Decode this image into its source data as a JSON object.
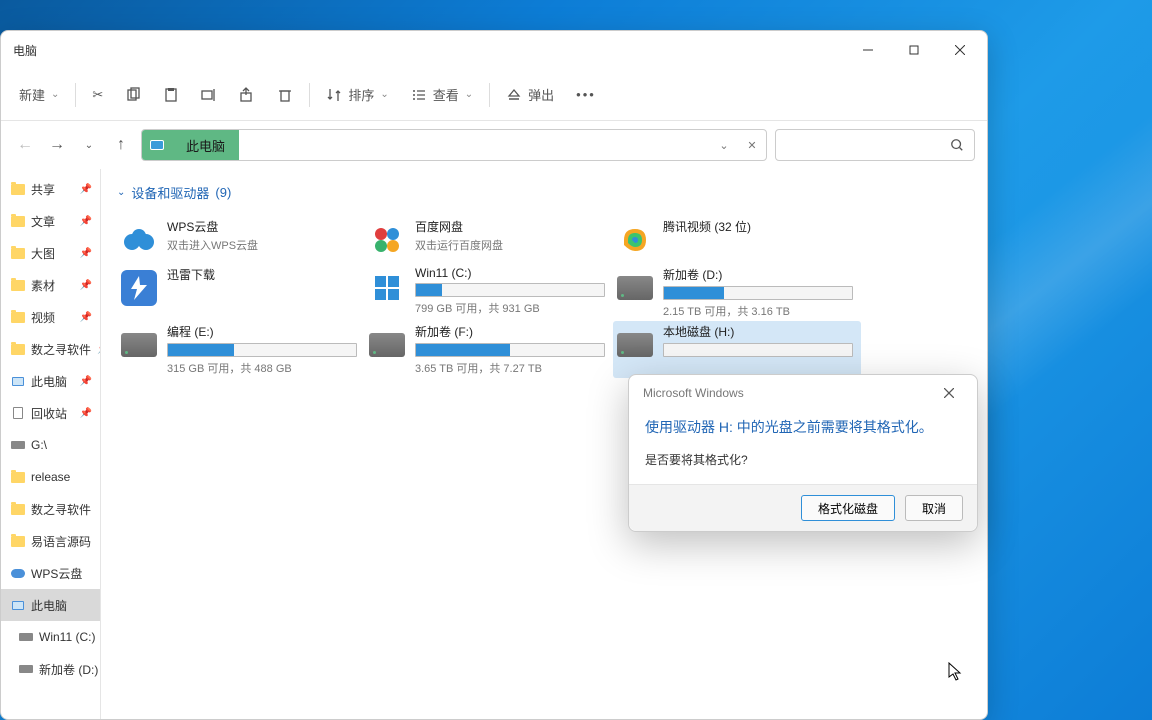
{
  "window": {
    "title": "电脑"
  },
  "toolbar": {
    "new": "新建",
    "sort": "排序",
    "view": "查看",
    "eject": "弹出"
  },
  "crumbs": {
    "current": "此电脑"
  },
  "sidebar": [
    {
      "label": "共享",
      "icon": "folder",
      "pinned": true
    },
    {
      "label": "文章",
      "icon": "folder",
      "pinned": true
    },
    {
      "label": "大图",
      "icon": "folder",
      "pinned": true
    },
    {
      "label": "素材",
      "icon": "folder",
      "pinned": true
    },
    {
      "label": "视频",
      "icon": "folder",
      "pinned": true
    },
    {
      "label": "数之寻软件",
      "icon": "folder",
      "pinned": true
    },
    {
      "label": "此电脑",
      "icon": "pc",
      "pinned": true
    },
    {
      "label": "回收站",
      "icon": "bin",
      "pinned": true
    },
    {
      "label": "G:\\",
      "icon": "drive",
      "pinned": false
    },
    {
      "label": "release",
      "icon": "folder",
      "pinned": false
    },
    {
      "label": "数之寻软件",
      "icon": "folder",
      "pinned": false
    },
    {
      "label": "易语言源码",
      "icon": "folder",
      "pinned": false
    },
    {
      "label": "WPS云盘",
      "icon": "cloud",
      "pinned": false
    },
    {
      "label": "此电脑",
      "icon": "pc",
      "pinned": false,
      "selected": true
    },
    {
      "label": "Win11 (C:)",
      "icon": "drive",
      "pinned": false,
      "indent": true
    },
    {
      "label": "新加卷 (D:)",
      "icon": "drive",
      "pinned": false,
      "indent": true
    }
  ],
  "group": {
    "title": "设备和驱动器",
    "count": "(9)"
  },
  "items": [
    {
      "name": "WPS云盘",
      "sub": "双击进入WPS云盘",
      "kind": "app",
      "icon": "wps"
    },
    {
      "name": "百度网盘",
      "sub": "双击运行百度网盘",
      "kind": "app",
      "icon": "baidu"
    },
    {
      "name": "腾讯视频 (32 位)",
      "sub": "",
      "kind": "app",
      "icon": "tencent"
    },
    {
      "name": "迅雷下载",
      "sub": "",
      "kind": "app",
      "icon": "thunder"
    },
    {
      "name": "Win11 (C:)",
      "sub": "799 GB 可用，共 931 GB",
      "kind": "drive",
      "fill": 14,
      "win": true
    },
    {
      "name": "新加卷 (D:)",
      "sub": "2.15 TB 可用，共 3.16 TB",
      "kind": "drive",
      "fill": 32
    },
    {
      "name": "编程 (E:)",
      "sub": "315 GB 可用，共 488 GB",
      "kind": "drive",
      "fill": 35
    },
    {
      "name": "新加卷 (F:)",
      "sub": "3.65 TB 可用，共 7.27 TB",
      "kind": "drive",
      "fill": 50
    },
    {
      "name": "本地磁盘 (H:)",
      "sub": "",
      "kind": "drive",
      "fill": 0,
      "selected": true
    }
  ],
  "dialog": {
    "title": "Microsoft Windows",
    "message": "使用驱动器 H: 中的光盘之前需要将其格式化。",
    "question": "是否要将其格式化?",
    "ok": "格式化磁盘",
    "cancel": "取消"
  }
}
